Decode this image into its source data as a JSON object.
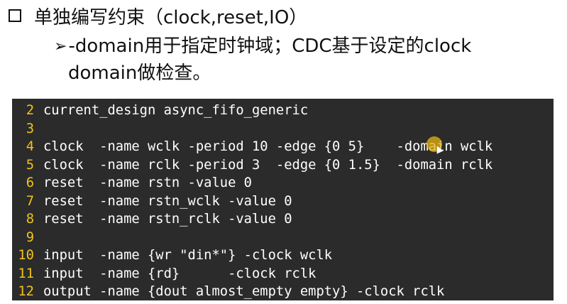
{
  "heading": {
    "text": "单独编写约束（clock,reset,IO）"
  },
  "sub_bullet": {
    "line1": "-domain用于指定时钟域；CDC基于设定的clock",
    "line2": "domain做检查。"
  },
  "code": {
    "lines": [
      {
        "num": "2",
        "text": "current_design async_fifo_generic"
      },
      {
        "num": "3",
        "text": ""
      },
      {
        "num": "4",
        "text": "clock  -name wclk -period 10 -edge {0 5}    -domain wclk"
      },
      {
        "num": "5",
        "text": "clock  -name rclk -period 3  -edge {0 1.5}  -domain rclk"
      },
      {
        "num": "6",
        "text": "reset  -name rstn -value 0"
      },
      {
        "num": "7",
        "text": "reset  -name rstn_wclk -value 0"
      },
      {
        "num": "8",
        "text": "reset  -name rstn_rclk -value 0"
      },
      {
        "num": "9",
        "text": ""
      },
      {
        "num": "10",
        "text": "input  -name {wr \"din*\"} -clock wclk"
      },
      {
        "num": "11",
        "text": "input  -name {rd}      -clock rclk"
      },
      {
        "num": "12",
        "text": "output -name {dout almost_empty empty} -clock rclk"
      }
    ]
  },
  "colors": {
    "code_background": "#2b2b2b",
    "line_number": "#f2c318",
    "code_text": "#ffffff",
    "cursor_highlight": "#e6b414"
  },
  "icons": {
    "bullet": "checkbox-icon",
    "sub_bullet": "arrow-icon"
  }
}
